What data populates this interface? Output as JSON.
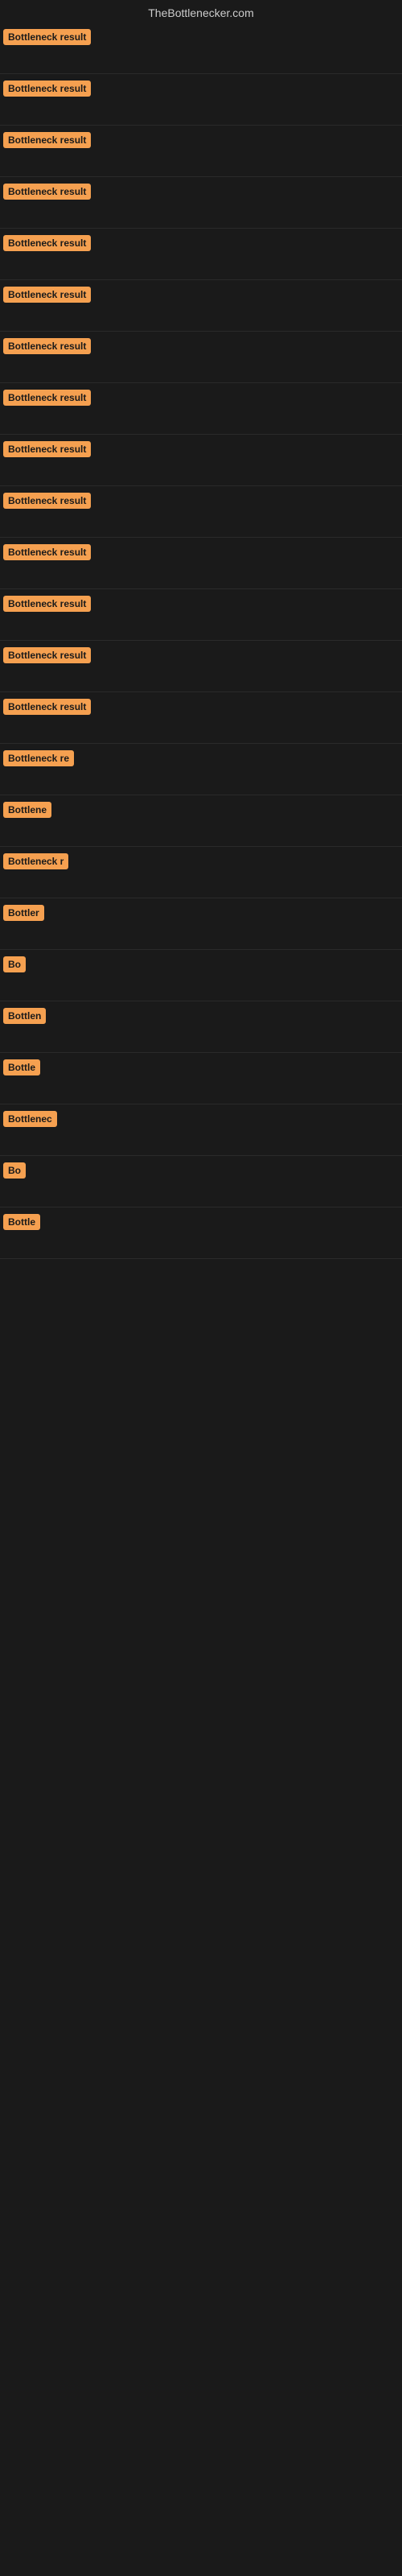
{
  "site": {
    "title": "TheBottlenecker.com"
  },
  "results": [
    {
      "id": 1,
      "label": "Bottleneck result",
      "width": 120
    },
    {
      "id": 2,
      "label": "Bottleneck result",
      "width": 120
    },
    {
      "id": 3,
      "label": "Bottleneck result",
      "width": 120
    },
    {
      "id": 4,
      "label": "Bottleneck result",
      "width": 120
    },
    {
      "id": 5,
      "label": "Bottleneck result",
      "width": 120
    },
    {
      "id": 6,
      "label": "Bottleneck result",
      "width": 120
    },
    {
      "id": 7,
      "label": "Bottleneck result",
      "width": 120
    },
    {
      "id": 8,
      "label": "Bottleneck result",
      "width": 120
    },
    {
      "id": 9,
      "label": "Bottleneck result",
      "width": 120
    },
    {
      "id": 10,
      "label": "Bottleneck result",
      "width": 120
    },
    {
      "id": 11,
      "label": "Bottleneck result",
      "width": 120
    },
    {
      "id": 12,
      "label": "Bottleneck result",
      "width": 120
    },
    {
      "id": 13,
      "label": "Bottleneck result",
      "width": 120
    },
    {
      "id": 14,
      "label": "Bottleneck result",
      "width": 115
    },
    {
      "id": 15,
      "label": "Bottleneck re",
      "width": 90
    },
    {
      "id": 16,
      "label": "Bottlene",
      "width": 70
    },
    {
      "id": 17,
      "label": "Bottleneck r",
      "width": 85
    },
    {
      "id": 18,
      "label": "Bottler",
      "width": 55
    },
    {
      "id": 19,
      "label": "Bo",
      "width": 30
    },
    {
      "id": 20,
      "label": "Bottlen",
      "width": 62
    },
    {
      "id": 21,
      "label": "Bottle",
      "width": 50
    },
    {
      "id": 22,
      "label": "Bottlenec",
      "width": 72
    },
    {
      "id": 23,
      "label": "Bo",
      "width": 30
    },
    {
      "id": 24,
      "label": "Bottle",
      "width": 50
    }
  ]
}
